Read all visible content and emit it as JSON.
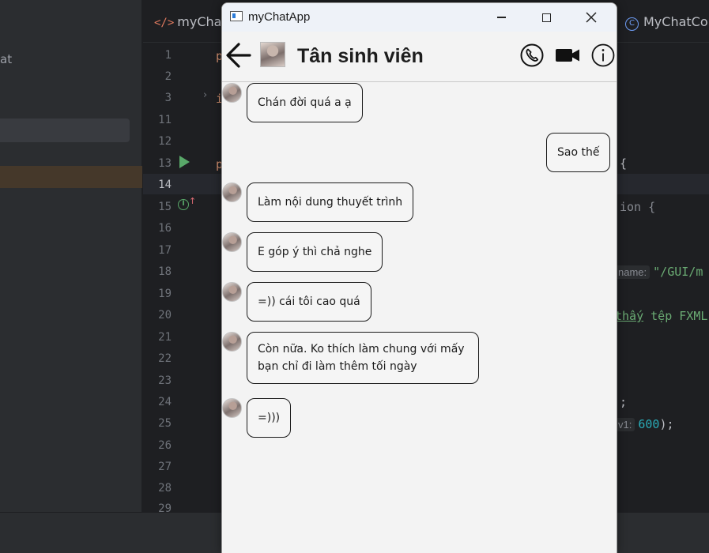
{
  "ide": {
    "sidebar_text": "at",
    "tabs": {
      "left_label": "myChat",
      "right_label": "MyChatCo"
    },
    "line_numbers": [
      "1",
      "2",
      "3",
      "11",
      "12",
      "13",
      "14",
      "15",
      "16",
      "17",
      "18",
      "19",
      "20",
      "21",
      "22",
      "23",
      "24",
      "25",
      "26",
      "27",
      "28",
      "29"
    ],
    "current_line": "14",
    "code": {
      "l1": "p",
      "l3": "i",
      "l13_kw": "p",
      "l13_tail": "{",
      "l15_tail": "ion {",
      "l18_hint": "name:",
      "l18_str": "\"/GUI/m",
      "l20_word": "thấy",
      "l20_rest": " tệp FXML",
      "l24_tail": ";",
      "l25_hint": "v1:",
      "l25_num": "600",
      "l25_tail": ");"
    }
  },
  "window": {
    "title": "myChatApp",
    "controls": {
      "minimize": "minimize",
      "maximize": "maximize",
      "close": "close"
    }
  },
  "chat": {
    "contact_name": "Tân sinh viên",
    "header_icons": [
      "back-arrow-icon",
      "phone-icon",
      "video-camera-icon",
      "info-icon"
    ],
    "messages": [
      {
        "side": "received",
        "text": "Chán đời quá a ạ"
      },
      {
        "side": "sent",
        "text": "Sao thế"
      },
      {
        "side": "received",
        "text": "Làm nội dung thuyết trình"
      },
      {
        "side": "received",
        "text": "E góp ý thì chả nghe"
      },
      {
        "side": "received",
        "text": "=)) cái tôi cao quá"
      },
      {
        "side": "received",
        "text": "Còn nữa. Ko thích làm chung với mấy bạn chỉ đi làm thêm tối ngày"
      },
      {
        "side": "received",
        "text": "=)))"
      }
    ]
  }
}
